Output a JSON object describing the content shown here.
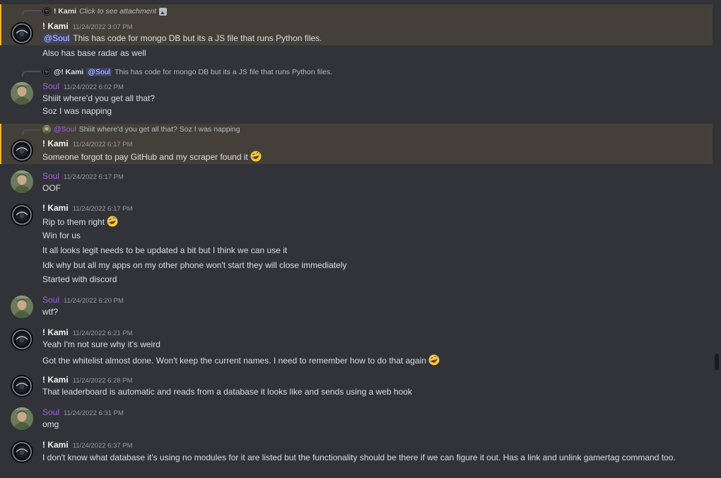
{
  "messages": {
    "m1": {
      "reply_user": "! Kami",
      "reply_text": "Click to see attachment",
      "user": "! Kami",
      "time": "11/24/2022 3:07 PM",
      "mention": "@Soul",
      "text1": "This has code for mongo DB but its a JS file that runs Python files.",
      "text2": "Also has base radar as well"
    },
    "m2": {
      "reply_user": "@! Kami",
      "reply_mention": "@Soul",
      "reply_text": "This has code for mongo DB but its a JS file that runs Python files.",
      "user": "Soul",
      "time": "11/24/2022 6:02 PM",
      "text1": "Shiiit where'd you get all that?",
      "text2": "Soz I was napping"
    },
    "m3": {
      "reply_user": "@Soul",
      "reply_text": "Shiiit where'd you get all that? Soz I was napping",
      "user": "! Kami",
      "time": "11/24/2022 6:17 PM",
      "text1": "Someone forgot to pay GitHub and my scraper found it"
    },
    "m4": {
      "user": "Soul",
      "time": "11/24/2022 6:17 PM",
      "text1": "OOF"
    },
    "m5": {
      "user": "! Kami",
      "time": "11/24/2022 6:17 PM",
      "text1": "Rip to them right",
      "text2": "Win for us",
      "text3": "It all looks legit needs to be updated a bit but I think we can use it",
      "text4": "Idk why but all my apps on my other phone won't start they will close immediately",
      "text5": "Started with discord"
    },
    "m6": {
      "user": "Soul",
      "time": "11/24/2022 6:20 PM",
      "text1": "wtf?"
    },
    "m7": {
      "user": "! Kami",
      "time": "11/24/2022 6:21 PM",
      "text1": "Yeah I'm not sure why it's weird",
      "text2": "Got the whitelist almost done. Won't keep the current names. I need to remember how to do that again"
    },
    "m8": {
      "user": "! Kami",
      "time": "11/24/2022 6:28 PM",
      "text1": "That leaderboard is automatic and reads from a database it looks like and sends using a web hook"
    },
    "m9": {
      "user": "Soul",
      "time": "11/24/2022 6:31 PM",
      "text1": "omg"
    },
    "m10": {
      "user": "! Kami",
      "time": "11/24/2022 6:37 PM",
      "text1": "I don't know what database it's using no modules for it are listed but the functionality should be there if we can figure it out. Has a link and unlink gamertag command too."
    }
  },
  "icons": {
    "kami_avatar": "dark-round-avatar-icon",
    "soul_avatar": "soldier-photo-avatar-icon",
    "attachment": "image-icon",
    "emoji": "rofl-emoji-icon"
  },
  "colors": {
    "background": "#313338",
    "highlight": "#444039",
    "highlight_border": "#f0b232",
    "soul_name": "#a35ee0",
    "mention_bg": "#3c4270"
  }
}
